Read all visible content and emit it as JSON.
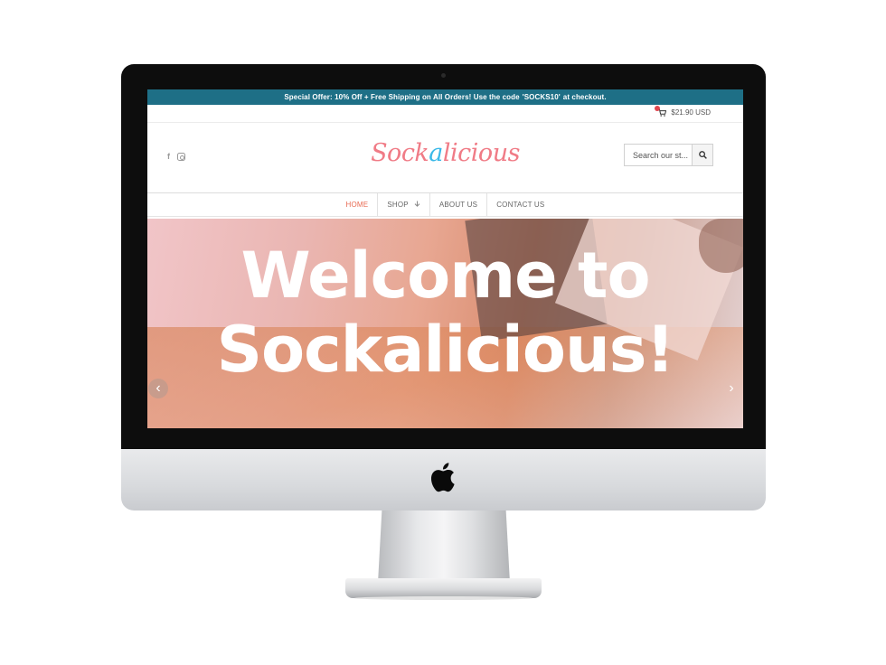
{
  "promo": {
    "text_before": "Special Offer: 10% Off + Free Shipping on All Orders! Use the code",
    "code": "'SOCKS10'",
    "text_after": "at checkout."
  },
  "cart": {
    "total": "$21.90 USD",
    "icon": "cart-icon"
  },
  "social": {
    "facebook_glyph": "f",
    "icons": [
      "facebook-icon",
      "instagram-icon"
    ]
  },
  "logo": {
    "part1": "Sock",
    "accent": "a",
    "part2": "licious"
  },
  "search": {
    "placeholder": "Search our st...",
    "icon": "search-icon"
  },
  "nav": {
    "items": [
      {
        "label": "HOME"
      },
      {
        "label": "SHOP"
      },
      {
        "label": "ABOUT US"
      },
      {
        "label": "CONTACT US"
      }
    ]
  },
  "hero": {
    "line1": "Welcome to",
    "line2": "Sockalicious!"
  },
  "slider": {
    "prev_glyph": "‹",
    "next_glyph": "›"
  },
  "colors": {
    "promo_bar": "#1e6f86",
    "logo_pink": "#f07b86",
    "logo_accent": "#3bb9e8",
    "nav_active": "#e86a52",
    "cart_badge": "#e0464f"
  }
}
